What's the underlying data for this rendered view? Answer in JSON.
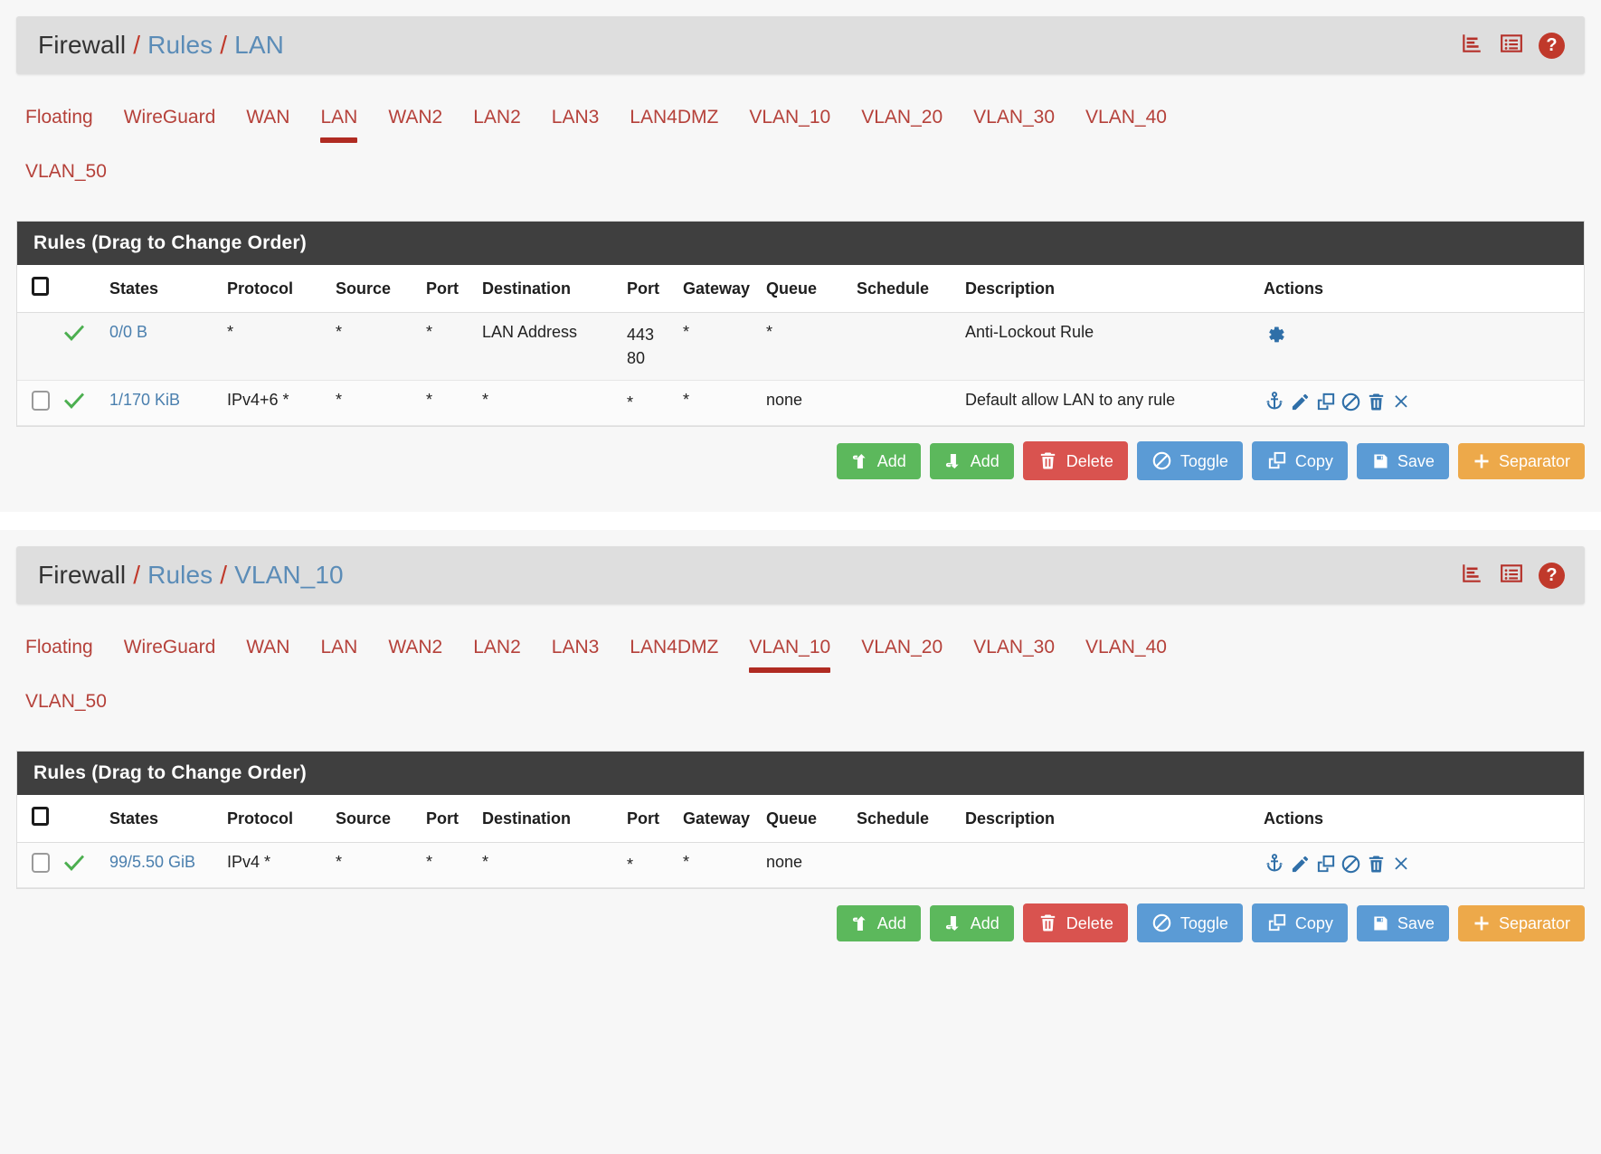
{
  "panels": [
    {
      "breadcrumb": {
        "root": "Firewall",
        "sep": "/",
        "link1": "Rules",
        "link2": "LAN"
      },
      "header_icons": {
        "stats": "chart-bar-icon",
        "list": "list-icon",
        "help": "?"
      },
      "tabs_row1": [
        {
          "label": "Floating",
          "active": false
        },
        {
          "label": "WireGuard",
          "active": false
        },
        {
          "label": "WAN",
          "active": false
        },
        {
          "label": "LAN",
          "active": true
        },
        {
          "label": "WAN2",
          "active": false
        },
        {
          "label": "LAN2",
          "active": false
        },
        {
          "label": "LAN3",
          "active": false
        },
        {
          "label": "LAN4DMZ",
          "active": false
        },
        {
          "label": "VLAN_10",
          "active": false
        },
        {
          "label": "VLAN_20",
          "active": false
        },
        {
          "label": "VLAN_30",
          "active": false
        },
        {
          "label": "VLAN_40",
          "active": false
        }
      ],
      "tabs_row2": [
        {
          "label": "VLAN_50",
          "active": false
        }
      ],
      "card_title": "Rules (Drag to Change Order)",
      "columns": [
        "States",
        "Protocol",
        "Source",
        "Port",
        "Destination",
        "Port",
        "Gateway",
        "Queue",
        "Schedule",
        "Description",
        "Actions"
      ],
      "rows": [
        {
          "has_checkbox": false,
          "status": "pass-check",
          "states": "0/0 B",
          "protocol": "*",
          "source": "*",
          "port_src": "*",
          "destination": "LAN Address",
          "port_dst": "443\n80",
          "gateway": "*",
          "queue": "*",
          "schedule": "",
          "description": "Anti-Lockout Rule",
          "actions": [
            "gear-icon"
          ]
        },
        {
          "has_checkbox": true,
          "status": "pass-check",
          "states": "1/170 KiB",
          "protocol": "IPv4+6 *",
          "source": "*",
          "port_src": "*",
          "destination": "*",
          "port_dst": "*",
          "gateway": "*",
          "queue": "none",
          "schedule": "",
          "description": "Default allow LAN to any rule",
          "actions": [
            "anchor-icon",
            "pencil-icon",
            "copy-icon",
            "block-icon",
            "trash-icon",
            "close-icon"
          ]
        }
      ],
      "buttons": [
        {
          "label": "Add",
          "icon": "arrow-up-icon",
          "style": "green"
        },
        {
          "label": "Add",
          "icon": "arrow-down-icon",
          "style": "green"
        },
        {
          "label": "Delete",
          "icon": "trash-icon",
          "style": "red"
        },
        {
          "label": "Toggle",
          "icon": "block-icon",
          "style": "blue"
        },
        {
          "label": "Copy",
          "icon": "copy-icon",
          "style": "blue"
        },
        {
          "label": "Save",
          "icon": "save-icon",
          "style": "blue"
        },
        {
          "label": "Separator",
          "icon": "plus-icon",
          "style": "orange"
        }
      ]
    },
    {
      "breadcrumb": {
        "root": "Firewall",
        "sep": "/",
        "link1": "Rules",
        "link2": "VLAN_10"
      },
      "header_icons": {
        "stats": "chart-bar-icon",
        "list": "list-icon",
        "help": "?"
      },
      "tabs_row1": [
        {
          "label": "Floating",
          "active": false
        },
        {
          "label": "WireGuard",
          "active": false
        },
        {
          "label": "WAN",
          "active": false
        },
        {
          "label": "LAN",
          "active": false
        },
        {
          "label": "WAN2",
          "active": false
        },
        {
          "label": "LAN2",
          "active": false
        },
        {
          "label": "LAN3",
          "active": false
        },
        {
          "label": "LAN4DMZ",
          "active": false
        },
        {
          "label": "VLAN_10",
          "active": true
        },
        {
          "label": "VLAN_20",
          "active": false
        },
        {
          "label": "VLAN_30",
          "active": false
        },
        {
          "label": "VLAN_40",
          "active": false
        }
      ],
      "tabs_row2": [
        {
          "label": "VLAN_50",
          "active": false
        }
      ],
      "card_title": "Rules (Drag to Change Order)",
      "columns": [
        "States",
        "Protocol",
        "Source",
        "Port",
        "Destination",
        "Port",
        "Gateway",
        "Queue",
        "Schedule",
        "Description",
        "Actions"
      ],
      "rows": [
        {
          "has_checkbox": true,
          "status": "pass-check",
          "states": "99/5.50 GiB",
          "protocol": "IPv4 *",
          "source": "*",
          "port_src": "*",
          "destination": "*",
          "port_dst": "*",
          "gateway": "*",
          "queue": "none",
          "schedule": "",
          "description": "",
          "actions": [
            "anchor-icon",
            "pencil-icon",
            "copy-icon",
            "block-icon",
            "trash-icon",
            "close-icon"
          ]
        }
      ],
      "buttons": [
        {
          "label": "Add",
          "icon": "arrow-up-icon",
          "style": "green"
        },
        {
          "label": "Add",
          "icon": "arrow-down-icon",
          "style": "green"
        },
        {
          "label": "Delete",
          "icon": "trash-icon",
          "style": "red"
        },
        {
          "label": "Toggle",
          "icon": "block-icon",
          "style": "blue"
        },
        {
          "label": "Copy",
          "icon": "copy-icon",
          "style": "blue"
        },
        {
          "label": "Save",
          "icon": "save-icon",
          "style": "blue"
        },
        {
          "label": "Separator",
          "icon": "plus-icon",
          "style": "orange"
        }
      ]
    }
  ],
  "colors": {
    "tab_red": "#b5413a",
    "active_underline": "#b02b22",
    "crumb_link": "#5b8cb7",
    "card_head_bg": "#3f3f3f",
    "states_link": "#4a7fae",
    "check_green": "#4caf50",
    "action_icon_blue": "#2f6fa8",
    "btn_green": "#5cb85c",
    "btn_red": "#d9534f",
    "btn_blue": "#5b9bd5",
    "btn_orange": "#eda94a"
  }
}
